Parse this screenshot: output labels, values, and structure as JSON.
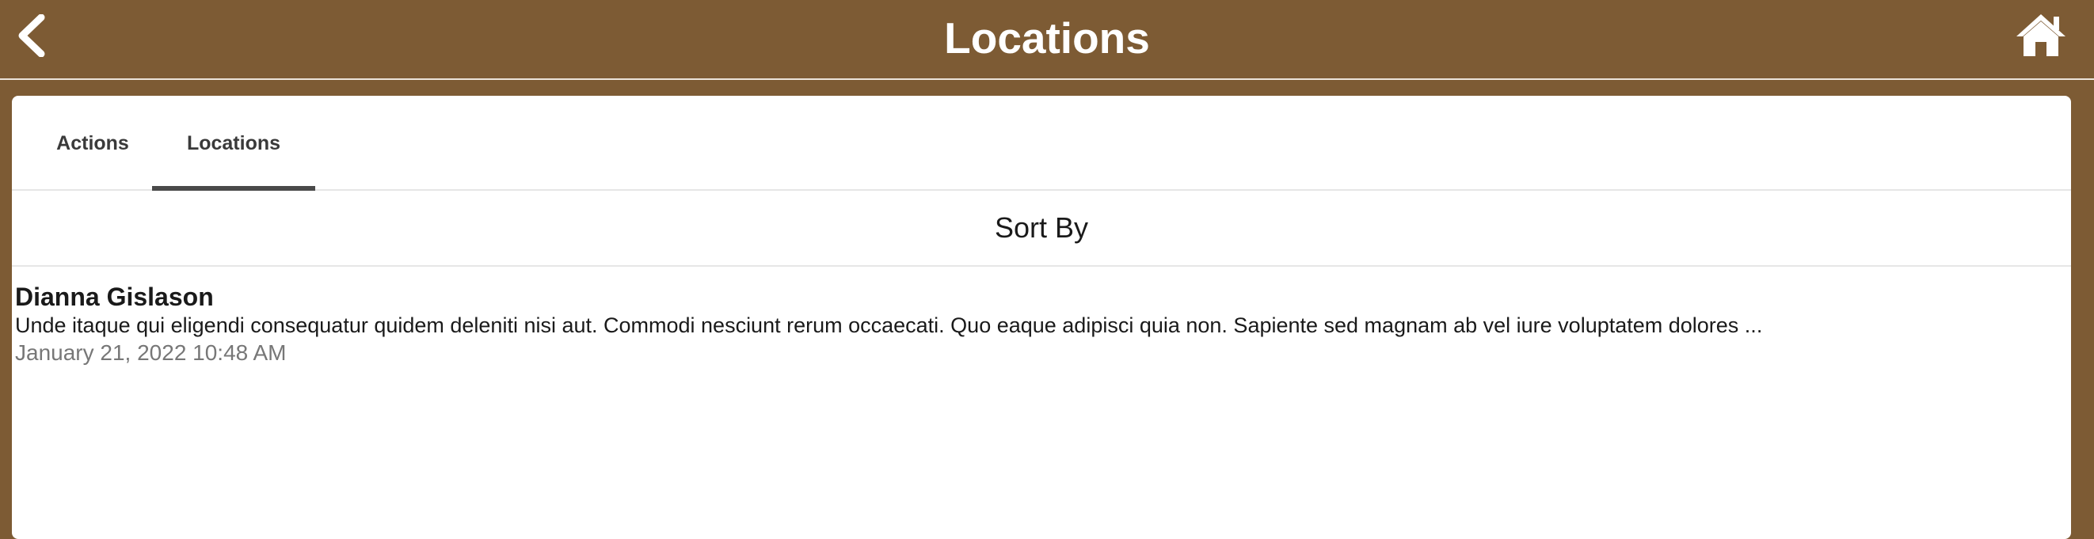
{
  "header": {
    "title": "Locations",
    "back_icon": "chevron-left-icon",
    "home_icon": "home-icon"
  },
  "tabs": [
    {
      "label": "Actions",
      "active": false
    },
    {
      "label": "Locations",
      "active": true
    }
  ],
  "sort": {
    "label": "Sort By"
  },
  "items": [
    {
      "name": "Dianna Gislason",
      "description": "Unde itaque qui eligendi consequatur quidem deleniti nisi aut. Commodi nesciunt rerum occaecati. Quo eaque adipisci quia non. Sapiente sed magnam ab vel iure voluptatem dolores ...",
      "date": "January 21, 2022 10:48 AM"
    }
  ],
  "colors": {
    "header_bg": "#7d5b34",
    "panel_bg": "#ffffff",
    "tab_indicator": "#4a4a4a",
    "date_text": "#777777"
  }
}
